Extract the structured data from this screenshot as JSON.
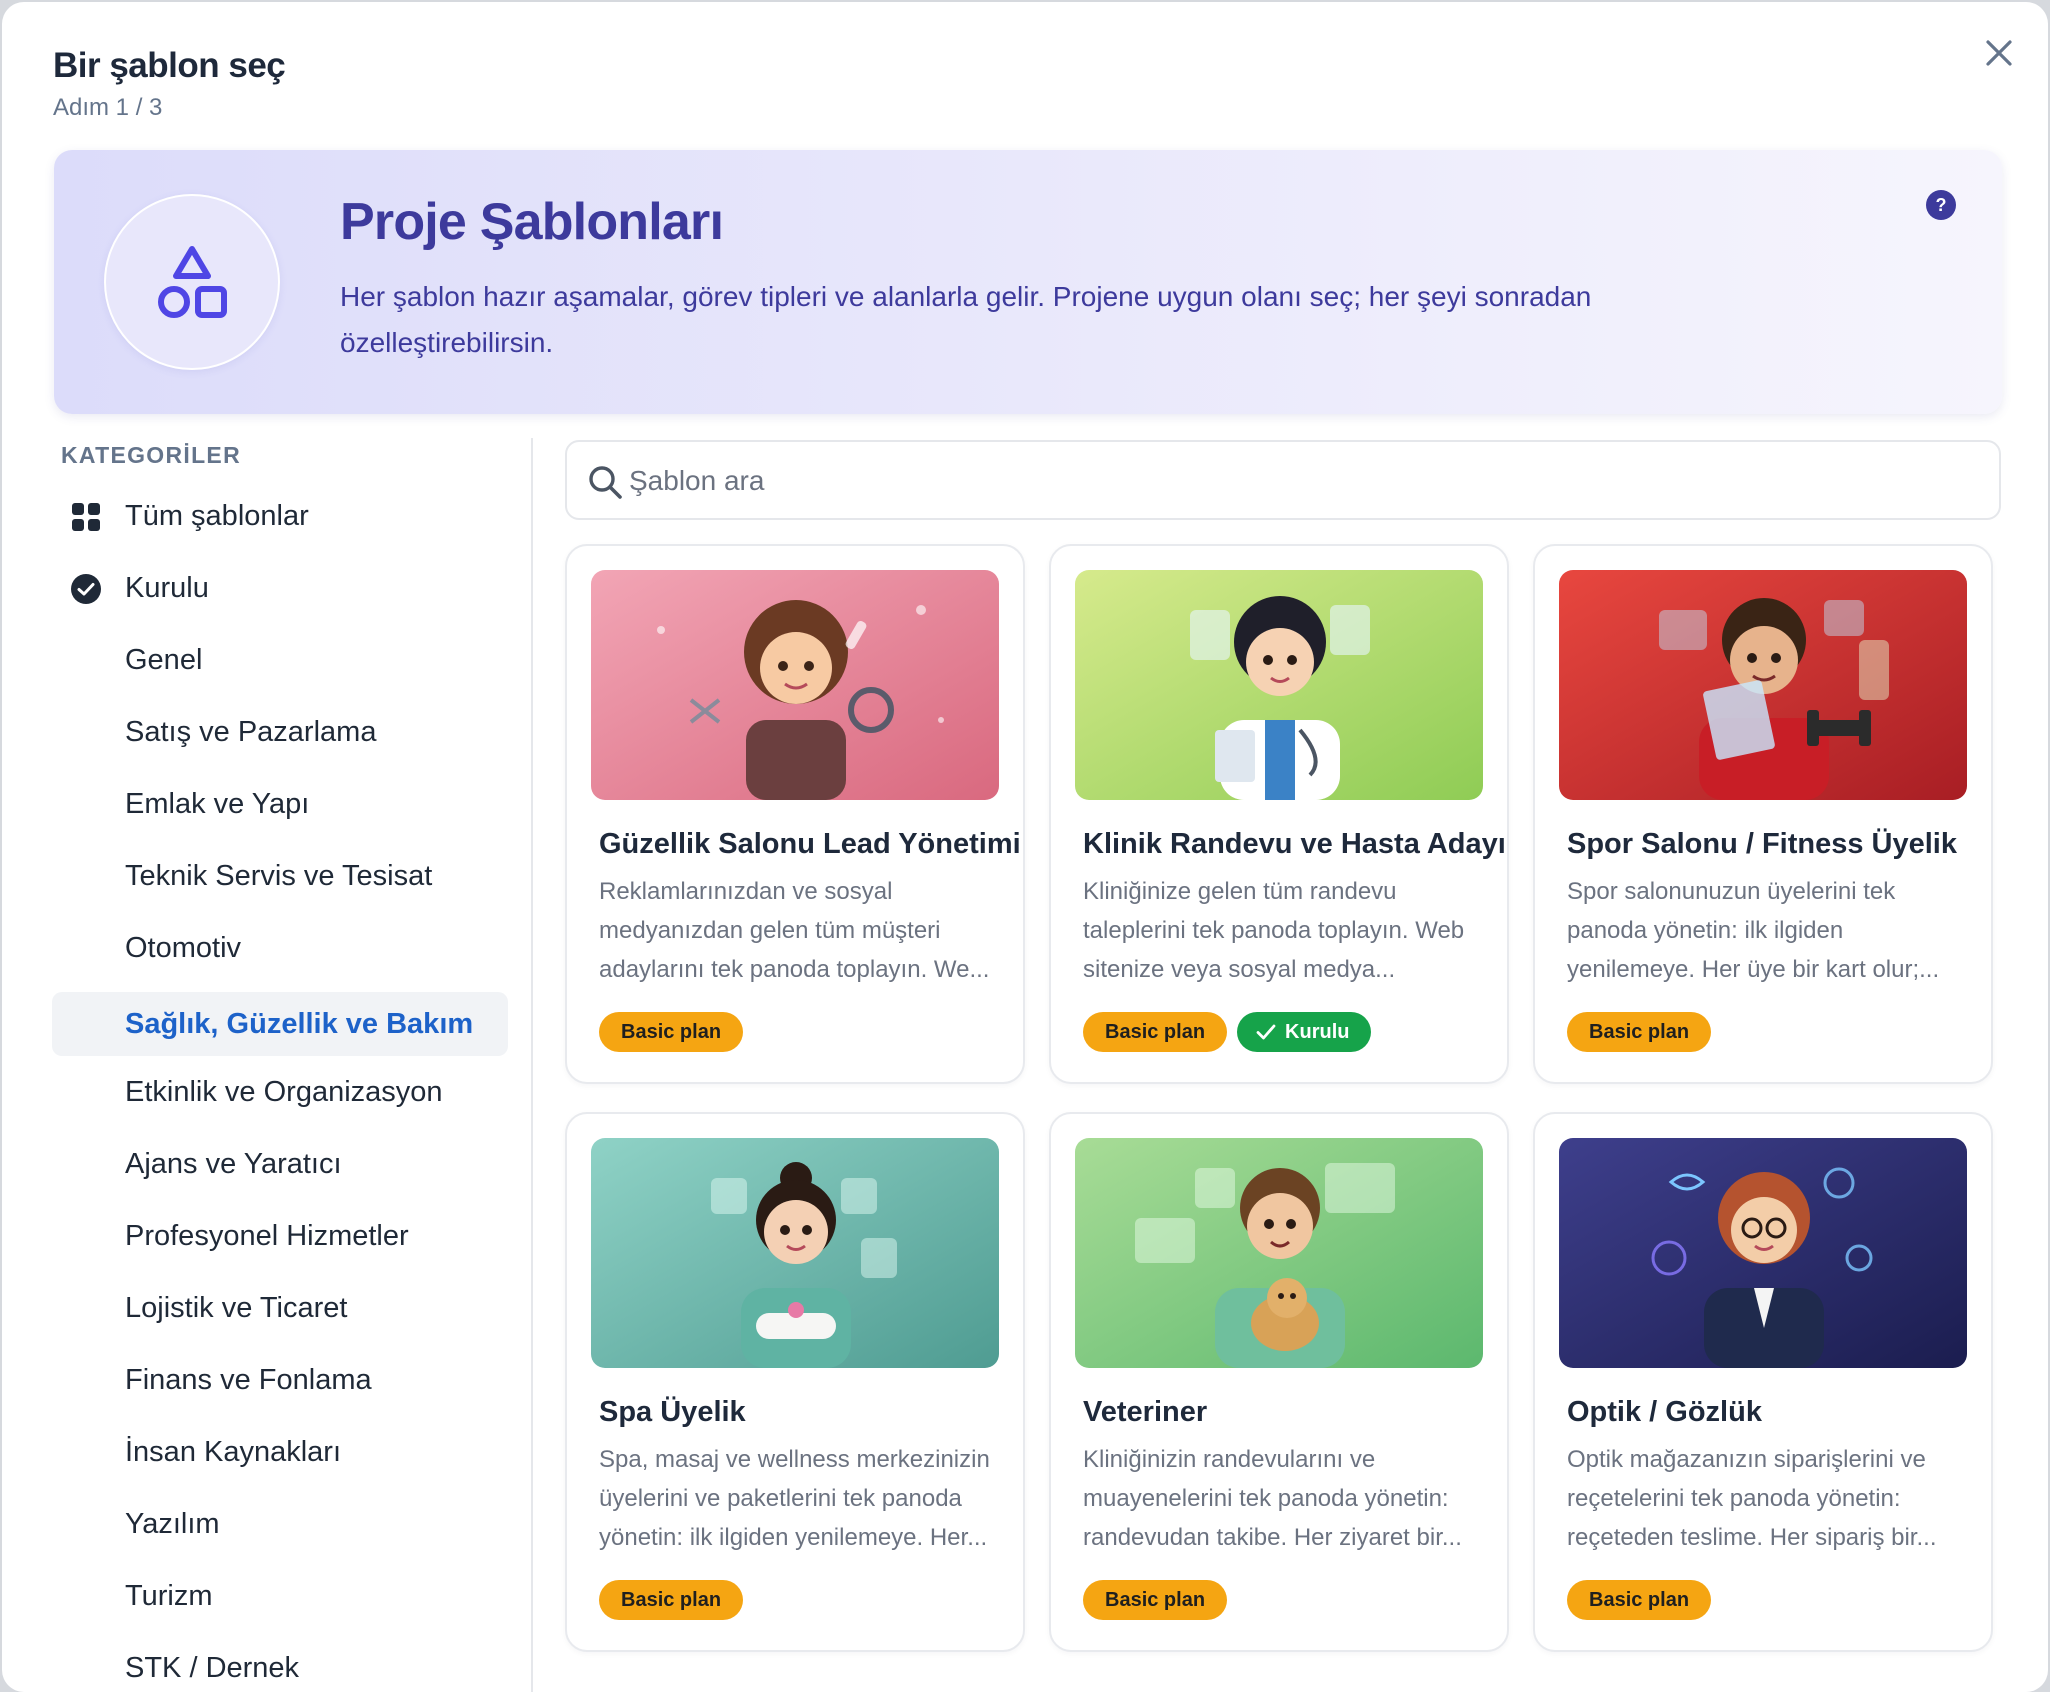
{
  "modal": {
    "title": "Bir şablon seç",
    "step": "Adım 1 / 3",
    "close_icon": "close-icon"
  },
  "hero": {
    "icon": "shapes-icon",
    "title": "Proje Şablonları",
    "description": "Her şablon hazır aşamalar, görev tipleri ve alanlarla gelir. Projene uygun olanı seç; her şeyi sonradan özelleştirebilirsin.",
    "help_label": "?"
  },
  "sidebar": {
    "heading": "KATEGORİLER",
    "items": [
      {
        "label": "Tüm şablonlar",
        "icon": "grid-icon"
      },
      {
        "label": "Kurulu",
        "icon": "check-circle-icon"
      },
      {
        "label": "Genel"
      },
      {
        "label": "Satış ve Pazarlama"
      },
      {
        "label": "Emlak ve Yapı"
      },
      {
        "label": "Teknik Servis ve Tesisat"
      },
      {
        "label": "Otomotiv"
      },
      {
        "label": "Sağlık, Güzellik ve Bakım",
        "active": true
      },
      {
        "label": "Etkinlik ve Organizasyon"
      },
      {
        "label": "Ajans ve Yaratıcı"
      },
      {
        "label": "Profesyonel Hizmetler"
      },
      {
        "label": "Lojistik ve Ticaret"
      },
      {
        "label": "Finans ve Fonlama"
      },
      {
        "label": "İnsan Kaynakları"
      },
      {
        "label": "Yazılım"
      },
      {
        "label": "Turizm"
      },
      {
        "label": "STK / Dernek"
      }
    ]
  },
  "search": {
    "placeholder": "Şablon ara",
    "value": ""
  },
  "templates": [
    {
      "title": "Güzellik Salonu Lead Yönetimi",
      "description": "Reklamlarınızdan ve sosyal medyanızdan gelen tüm müşteri adaylarını tek panoda toplayın. We...",
      "plan": "Basic plan",
      "image_colors": [
        "#f2a5b5",
        "#d9697f"
      ]
    },
    {
      "title": "Klinik Randevu ve Hasta Adayı",
      "description": "Kliniğinize gelen tüm randevu taleplerini tek panoda toplayın. Web sitenize veya sosyal medya...",
      "plan": "Basic plan",
      "installed": "Kurulu",
      "image_colors": [
        "#d6ea8c",
        "#8fcc55"
      ]
    },
    {
      "title": "Spor Salonu / Fitness Üyelik",
      "description": "Spor salonunuzun üyelerini tek panoda yönetin: ilk ilgiden yenilemeye. Her üye bir kart olur;...",
      "plan": "Basic plan",
      "image_colors": [
        "#e8473f",
        "#a81e24"
      ]
    },
    {
      "title": "Spa Üyelik",
      "description": "Spa, masaj ve wellness merkezinizin üyelerini ve paketlerini tek panoda yönetin: ilk ilgiden yenilemeye. Her...",
      "plan": "Basic plan",
      "image_colors": [
        "#8fd2c6",
        "#4f9c92"
      ]
    },
    {
      "title": "Veteriner",
      "description": "Kliniğinizin randevularını ve muayenelerini tek panoda yönetin: randevudan takibe. Her ziyaret bir...",
      "plan": "Basic plan",
      "image_colors": [
        "#a8dc96",
        "#5cb86e"
      ]
    },
    {
      "title": "Optik / Gözlük",
      "description": "Optik mağazanızın siparişlerini ve reçetelerini tek panoda yönetin: reçeteden teslime. Her sipariş bir...",
      "plan": "Basic plan",
      "image_colors": [
        "#3e3f8c",
        "#1b1d4f"
      ]
    }
  ],
  "colors": {
    "accent": "#3d3a9c",
    "active_link": "#1d62c9",
    "plan_badge": "#f5a512",
    "installed_badge": "#16a34a"
  }
}
